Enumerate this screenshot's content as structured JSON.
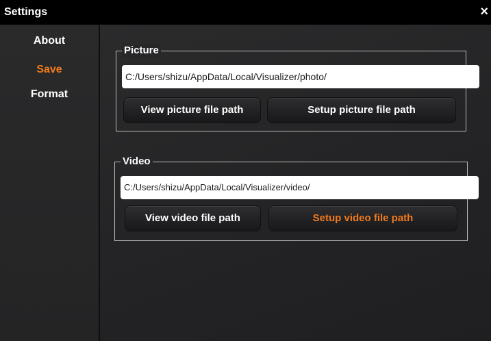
{
  "window": {
    "title": "Settings",
    "close_glyph": "×"
  },
  "sidebar": {
    "items": [
      {
        "label": "About",
        "active": false
      },
      {
        "label": "Save",
        "active": true
      },
      {
        "label": "Format",
        "active": false
      }
    ]
  },
  "picture": {
    "legend": "Picture",
    "path_value": "C:/Users/shizu/AppData/Local/Visualizer/photo/",
    "view_button": "View picture file path",
    "setup_button": "Setup picture file path"
  },
  "video": {
    "legend": "Video",
    "path_value": "C:/Users/shizu/AppData/Local/Visualizer/video/",
    "view_button": "View video file path",
    "setup_button": "Setup video file path"
  },
  "colors": {
    "accent": "#f07a1c",
    "background": "#222224",
    "titlebar": "#000000"
  },
  "icons": {
    "close": "close-icon"
  }
}
